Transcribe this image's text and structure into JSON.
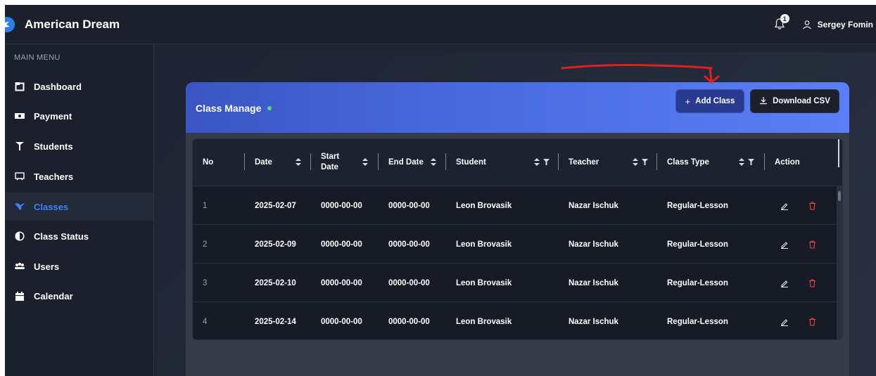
{
  "app": {
    "title": "American Dream"
  },
  "header": {
    "notification_count": "1",
    "user_name": "Sergey Fomin"
  },
  "sidebar": {
    "caption": "MAIN MENU",
    "items": [
      {
        "label": "Dashboard",
        "icon": "dashboard-icon"
      },
      {
        "label": "Payment",
        "icon": "payment-icon"
      },
      {
        "label": "Students",
        "icon": "students-icon"
      },
      {
        "label": "Teachers",
        "icon": "teachers-icon"
      },
      {
        "label": "Classes",
        "icon": "classes-icon",
        "active": true
      },
      {
        "label": "Class Status",
        "icon": "class-status-icon"
      },
      {
        "label": "Users",
        "icon": "users-icon"
      },
      {
        "label": "Calendar",
        "icon": "calendar-icon"
      }
    ]
  },
  "card": {
    "title": "Class Manage",
    "add_label": "Add Class",
    "csv_label": "Download CSV"
  },
  "table": {
    "columns": [
      "No",
      "Date",
      "Start Date",
      "End Date",
      "Student",
      "Teacher",
      "Class Type",
      "Action"
    ],
    "rows": [
      {
        "no": "1",
        "date": "2025-02-07",
        "start": "0000-00-00",
        "end": "0000-00-00",
        "student": "Leon Brovasik",
        "teacher": "Nazar Ischuk",
        "type": "Regular-Lesson"
      },
      {
        "no": "2",
        "date": "2025-02-09",
        "start": "0000-00-00",
        "end": "0000-00-00",
        "student": "Leon Brovasik",
        "teacher": "Nazar Ischuk",
        "type": "Regular-Lesson"
      },
      {
        "no": "3",
        "date": "2025-02-10",
        "start": "0000-00-00",
        "end": "0000-00-00",
        "student": "Leon Brovasik",
        "teacher": "Nazar Ischuk",
        "type": "Regular-Lesson"
      },
      {
        "no": "4",
        "date": "2025-02-14",
        "start": "0000-00-00",
        "end": "0000-00-00",
        "student": "Leon Brovasik",
        "teacher": "Nazar Ischuk",
        "type": "Regular-Lesson"
      }
    ]
  },
  "colors": {
    "accent": "#3b82f6",
    "header_gradient_start": "#3b56c4",
    "header_gradient_end": "#5b7ef6",
    "delete": "#ef4444",
    "annotation": "#e02020"
  }
}
